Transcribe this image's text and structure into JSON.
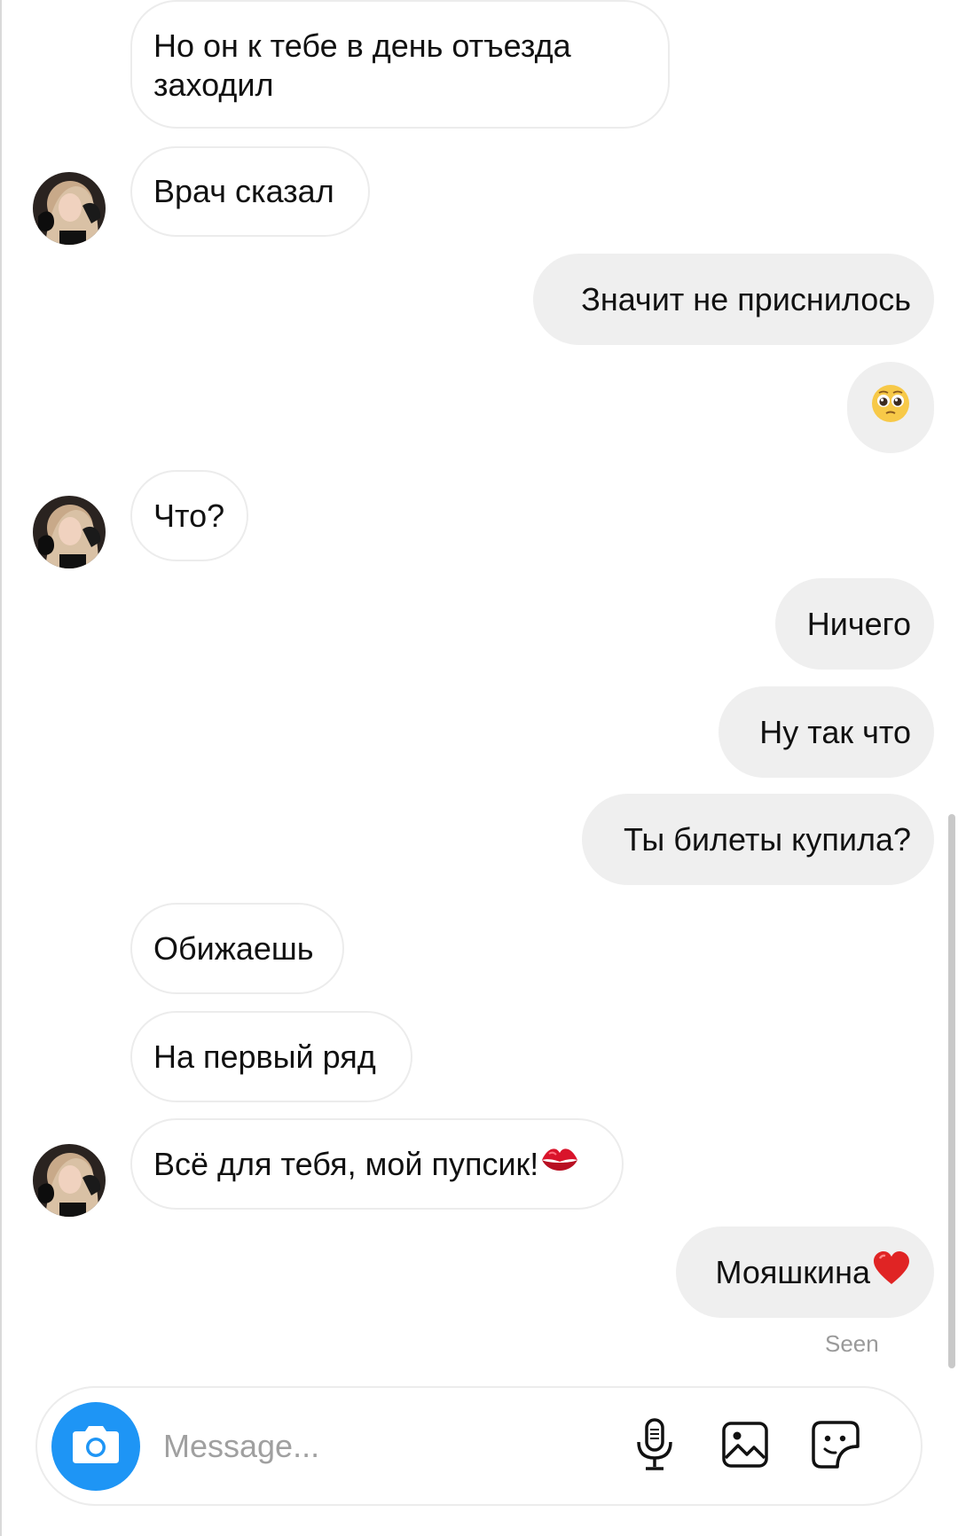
{
  "conversation": {
    "messages": [
      {
        "direction": "incoming",
        "text": "Но он к тебе в день отъезда заходил"
      },
      {
        "direction": "incoming",
        "text": "Врач сказал"
      },
      {
        "direction": "outgoing",
        "text": "Значит не приснилось"
      },
      {
        "direction": "outgoing",
        "text": "🥺",
        "emoji_only": true
      },
      {
        "direction": "incoming",
        "text": "Что?"
      },
      {
        "direction": "outgoing",
        "text": "Ничего"
      },
      {
        "direction": "outgoing",
        "text": "Ну так что"
      },
      {
        "direction": "outgoing",
        "text": "Ты билеты купила?"
      },
      {
        "direction": "incoming",
        "text": "Обижаешь"
      },
      {
        "direction": "incoming",
        "text": "На первый ряд"
      },
      {
        "direction": "incoming",
        "text": "Всё для тебя, мой пупсик!",
        "trailing_icon": "kiss-mark-icon"
      },
      {
        "direction": "outgoing",
        "text": "Мояшкина",
        "trailing_icon": "red-heart-icon"
      }
    ],
    "seen_label": "Seen"
  },
  "composer": {
    "placeholder": "Message...",
    "camera_icon": "camera-icon",
    "tools": [
      "microphone-icon",
      "gallery-icon",
      "sticker-icon"
    ]
  },
  "colors": {
    "outgoing_bubble": "#efefef",
    "incoming_border": "#ececec",
    "camera_button": "#1e95f5",
    "seen_text": "#9a9a9a"
  }
}
